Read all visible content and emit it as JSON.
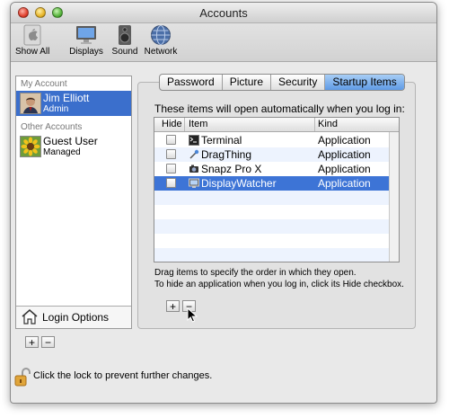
{
  "window": {
    "title": "Accounts"
  },
  "toolbar": {
    "items": [
      {
        "label": "Show All",
        "icon": "apple-icon"
      },
      {
        "label": "Displays",
        "icon": "display-icon"
      },
      {
        "label": "Sound",
        "icon": "speaker-icon"
      },
      {
        "label": "Network",
        "icon": "globe-icon"
      }
    ]
  },
  "sidebar": {
    "my_account_header": "My Account",
    "my_account": {
      "name": "Jim Elliott",
      "role": "Admin"
    },
    "other_accounts_header": "Other Accounts",
    "other_accounts": [
      {
        "name": "Guest User",
        "role": "Managed"
      }
    ],
    "login_options": "Login Options",
    "add_label": "+",
    "remove_label": "−"
  },
  "tabs": [
    {
      "label": "Password",
      "active": false
    },
    {
      "label": "Picture",
      "active": false
    },
    {
      "label": "Security",
      "active": false
    },
    {
      "label": "Startup Items",
      "active": true
    }
  ],
  "startup": {
    "instruction": "These items will open automatically when you log in:",
    "columns": {
      "hide": "Hide",
      "item": "Item",
      "kind": "Kind"
    },
    "items": [
      {
        "name": "Terminal",
        "kind": "Application",
        "hidden": false,
        "selected": false,
        "icon": "terminal-icon"
      },
      {
        "name": "DragThing",
        "kind": "Application",
        "hidden": false,
        "selected": false,
        "icon": "dragthing-icon"
      },
      {
        "name": "Snapz Pro X",
        "kind": "Application",
        "hidden": false,
        "selected": false,
        "icon": "snapz-icon"
      },
      {
        "name": "DisplayWatcher",
        "kind": "Application",
        "hidden": false,
        "selected": true,
        "icon": "displaywatcher-icon"
      }
    ],
    "help_line1": "Drag items to specify the order in which they open.",
    "help_line2": "To hide an application when you log in, click its Hide checkbox.",
    "add_label": "+",
    "remove_label": "−"
  },
  "footer": {
    "lock_text": "Click the lock to prevent further changes."
  },
  "colors": {
    "selection": "#3d74d6",
    "tab_active": "#5f9ae6"
  }
}
